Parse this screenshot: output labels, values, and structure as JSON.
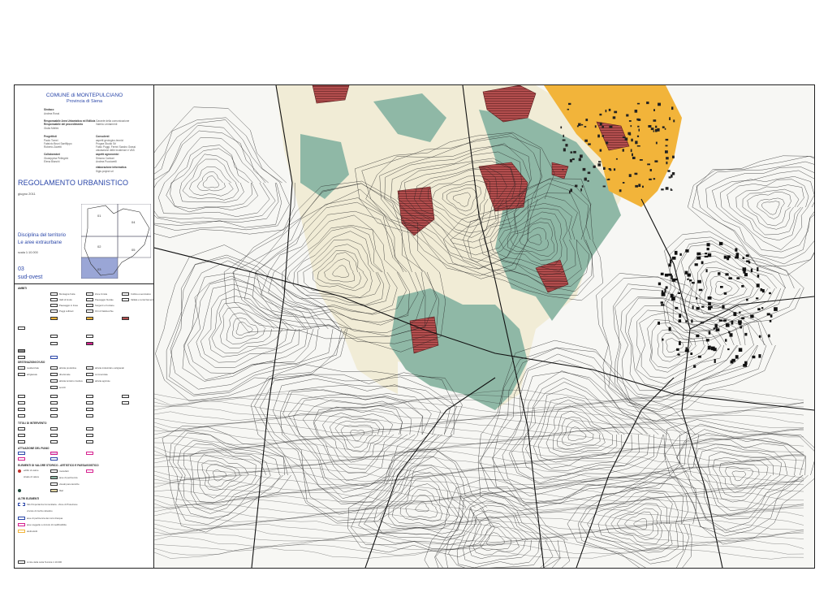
{
  "header": {
    "municipality": "COMUNE di MONTEPULCIANO",
    "province": "Provincia di Siena"
  },
  "credits": {
    "sindaco_label": "Sindaco",
    "sindaco_name": "Andrea Rossi",
    "resp_label": "Responsabile Area Urbanistica ed Edilizia",
    "resp_name": "Giulia Mellini",
    "garante_label": "Garante della comunicazione",
    "garante_name": "Valeria Lentamenti",
    "resp2_label": "Responsabile del procedimento",
    "resp2_name": "Massimo Bertone",
    "progettisti_label": "Progettisti",
    "progettisti": [
      "Paolo Tomei",
      "Fabrizio Bruni Sanfilippo",
      "Roberto Zavetti"
    ],
    "consulenti_label": "Consulenti",
    "consulenti": [
      "aspetti geologico-tecnici",
      "Progea Studio Srl",
      "Fabio Poggi, Ferrini Sandro Grassi",
      "valutazione delle incidenze e VAS"
    ],
    "collaboratori_label": "Collaboratori",
    "collaboratori": [
      "Giuseppina Pellegrini",
      "Elena Bianchi"
    ],
    "aspetti_label": "aspetti agronomici",
    "aspetti": [
      "Simona Carboni",
      "Andrea Pucciarelli"
    ],
    "elab_label": "elaborazione informatica",
    "elab_name": "Sigis project srl"
  },
  "document": {
    "title": "REGOLAMENTO URBANISTICO",
    "date": "giugno 2011",
    "section_line1": "Disciplina del territorio",
    "section_line2": "Le aree extraurbane",
    "scale": "scala 1:10.000",
    "sheet_number": "03",
    "sheet_name": "sud-ovest"
  },
  "key_map": {
    "tiles": [
      "01",
      "04",
      "02",
      "05",
      "03"
    ],
    "active_tile": "03",
    "active_color": "#9aa6d6"
  },
  "legend": {
    "ambiti_header": "AMBITI",
    "destinazioni_header": "DESTINAZIONI D'USO",
    "titoli_header": "TITOLI DI INTERVENTO",
    "attuazione_header": "ATTUAZIONE DEL PIANO",
    "elementi_header": "ELEMENTI DI VALORE STORICO - ARTISTICO E PAESAGGISTICO",
    "altri_header": "ALTRI ELEMENTI",
    "ambiti_items": [
      "Montagna fruita",
      "Zone Umide",
      "Collina a seminativo",
      "Valli di fondo",
      "Paesaggio fluviale",
      "Vallata e terrazzamenti",
      "Paesaggio in linea",
      "Sorgenti e Fontane",
      "Poggi collinari",
      "Orti di Valdrecchie"
    ],
    "dest_items": [
      "residenziale",
      "attivita produttive",
      "attivita industriali e artigianali",
      "artigianale",
      "direzionale",
      "commerciale",
      "attivita turistico ricettive",
      "attivita agricole",
      "servizi",
      "parcheggi"
    ],
    "elementi_items": [
      "edifici di valore",
      "manufatti",
      "strade di valore",
      "aree di pertinenza",
      "visuali panoramiche",
      "filari"
    ],
    "altri_items": [
      "Siti d'Importanza Comunitaria - Zone di Protezione",
      "vincolo di rischio idraulico",
      "aree di pertinenza dei corsi d'acqua",
      "aree soggette a vincolo di inedificabilita",
      "elettrodotti"
    ],
    "footer": "Limite della carta Tecnica 1:10.000"
  },
  "map_colors": {
    "green": "#8fb8a6",
    "cream": "#f1ecd6",
    "red": "#b34e4e",
    "orange": "#f2b43a",
    "contour": "#222222"
  }
}
